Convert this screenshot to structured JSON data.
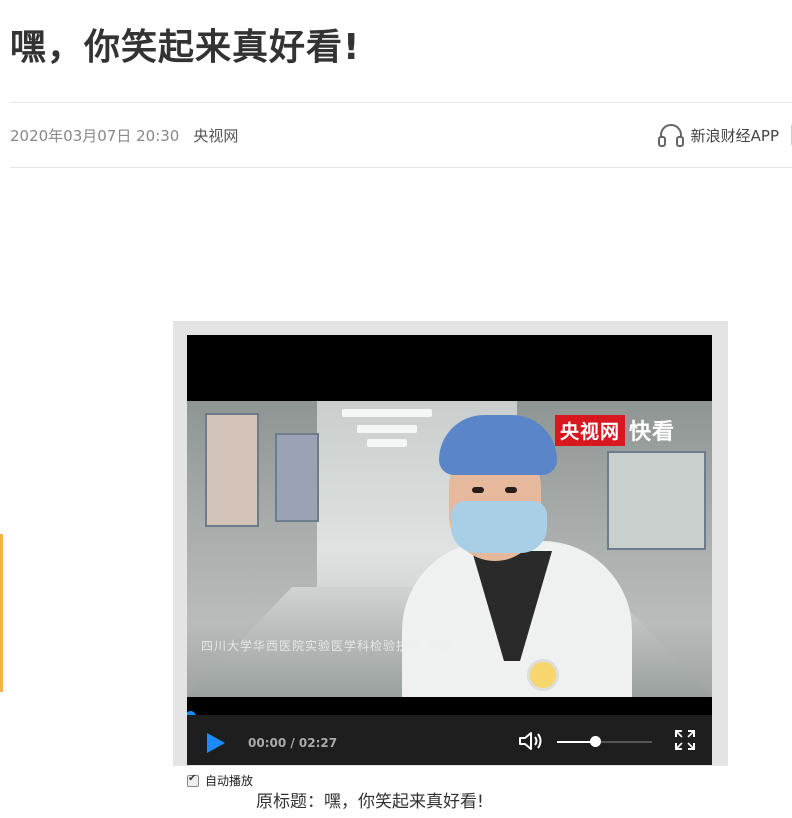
{
  "article": {
    "title": "嘿，你笑起来真好看!",
    "date": "2020年03月07日 20:30",
    "source": "央视网",
    "app_label": "新浪财经APP",
    "original_title": "原标题：嘿，你笑起来真好看!"
  },
  "video": {
    "logo_red": "央视网",
    "logo_white": "快看",
    "caption": "四川大学华西医院实验医学科检验技师 刘颖",
    "time": "00:00 / 02:27",
    "progress": 0,
    "buffered": 0.3,
    "volume": 0.4,
    "autoplay_label": "自动播放",
    "autoplay_checked": true
  },
  "colors": {
    "accent": "#1a8cff",
    "logo_red": "#d8171e",
    "side_tab": "#f1b24a"
  }
}
